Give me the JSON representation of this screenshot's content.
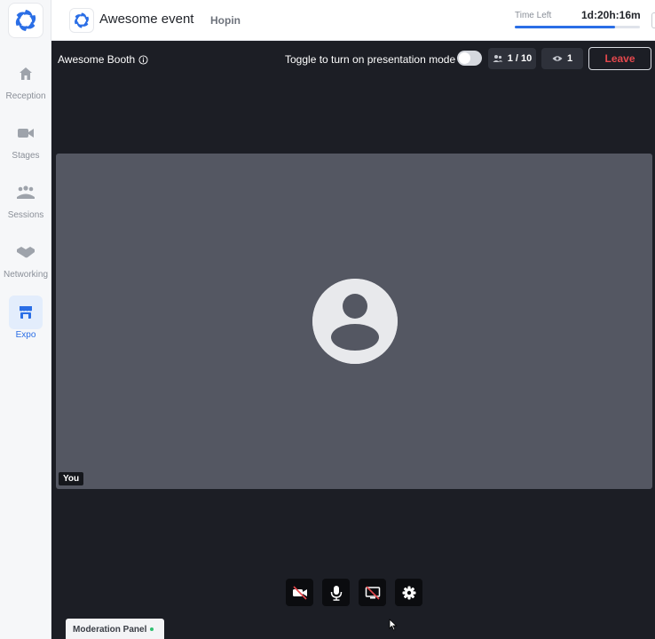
{
  "sidebar": {
    "items": [
      {
        "label": "Reception",
        "icon": "home-icon",
        "active": false
      },
      {
        "label": "Stages",
        "icon": "video-camera-icon",
        "active": false
      },
      {
        "label": "Sessions",
        "icon": "group-icon",
        "active": false
      },
      {
        "label": "Networking",
        "icon": "handshake-icon",
        "active": false
      },
      {
        "label": "Expo",
        "icon": "booth-icon",
        "active": true
      }
    ]
  },
  "header": {
    "event_title": "Awesome event",
    "organizer": "Hopin",
    "time_left_label": "Time Left",
    "time_left_value": "1d:20h:16m",
    "time_progress": 0.8
  },
  "booth": {
    "name": "Awesome Booth",
    "presentation_toggle_label": "Toggle to turn on presentation mode",
    "presentation_mode_on": false,
    "participants": "1 / 10",
    "viewers": "1",
    "leave_label": "Leave"
  },
  "video": {
    "self_label": "You"
  },
  "controls": [
    "camera-off-icon",
    "microphone-icon",
    "screen-share-off-icon",
    "settings-gear-icon"
  ],
  "moderation_panel": {
    "label": "Moderation Panel"
  },
  "colors": {
    "accent": "#2a6ee6",
    "leave": "#e5484d",
    "stage_bg": "#1c1e25",
    "video_tile": "#545762",
    "online_dot": "#2fbf71"
  }
}
